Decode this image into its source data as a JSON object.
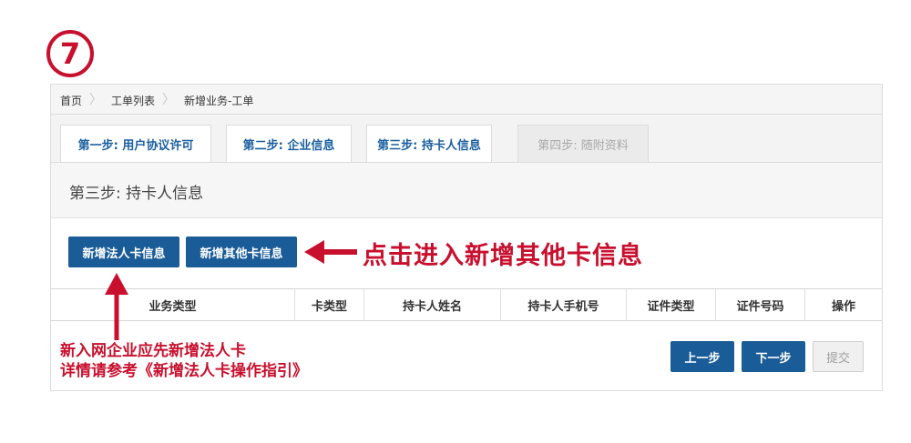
{
  "step_badge": {
    "label": "7",
    "color": "#c8102e"
  },
  "breadcrumb": {
    "items": [
      {
        "label": "首页"
      },
      {
        "label": "工单列表"
      },
      {
        "label": "新增业务-工单"
      }
    ]
  },
  "tabs": [
    {
      "label": "第一步: 用户协议许可",
      "state": "done"
    },
    {
      "label": "第二步: 企业信息",
      "state": "done"
    },
    {
      "label": "第三步: 持卡人信息",
      "state": "active"
    },
    {
      "label": "第四步: 随附资料",
      "state": "disabled"
    }
  ],
  "section": {
    "title": "第三步: 持卡人信息"
  },
  "actions": {
    "add_legal": "新增法人卡信息",
    "add_other": "新增其他卡信息"
  },
  "table": {
    "columns": [
      "业务类型",
      "卡类型",
      "持卡人姓名",
      "持卡人手机号",
      "证件类型",
      "证件号码",
      "操作"
    ]
  },
  "footer": {
    "prev": "上一步",
    "next": "下一步",
    "submit": "提交"
  },
  "annotations": {
    "right": "点击进入新增其他卡信息",
    "bottom_line1": "新入网企业应先新增法人卡",
    "bottom_line2": "详情请参考《新增法人卡操作指引》"
  },
  "colors": {
    "primary": "#1a5c97",
    "accent_red": "#c8102e",
    "tab_text": "#1a5fa0",
    "disabled": "#a0a0a0"
  }
}
